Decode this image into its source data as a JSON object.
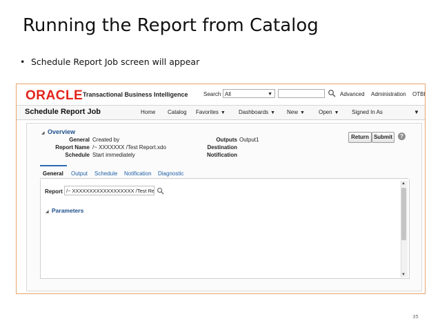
{
  "slide": {
    "title": "Running the Report from Catalog",
    "bullet_symbol": "•",
    "bullet": "Schedule Report Job screen will appear",
    "page_number": "35"
  },
  "app": {
    "logo": "ORACLE",
    "product": "Transactional Business Intelligence",
    "search_label": "Search",
    "search_scope": "All",
    "search_value": "",
    "top_links": [
      "Advanced",
      "Administration",
      "OTBI"
    ]
  },
  "nav": {
    "page_heading": "Schedule Report Job",
    "links": [
      "Home",
      "Catalog",
      "Favorites",
      "Dashboards",
      "New",
      "Open",
      "Signed In As"
    ]
  },
  "overview": {
    "title": "Overview",
    "general_label": "General",
    "general_value": "Created by",
    "report_name_label": "Report Name",
    "report_name_value": "/~  XXXXXXX  /Test Report.xdo",
    "schedule_label": "Schedule",
    "schedule_value": "Start immediately",
    "outputs_label": "Outputs",
    "outputs_value": "Output1",
    "destination_label": "Destination",
    "notification_label": "Notification",
    "return_button": "Return",
    "submit_button": "Submit",
    "help": "?"
  },
  "tabs": [
    "General",
    "Output",
    "Schedule",
    "Notification",
    "Diagnostic"
  ],
  "active_tab": "General",
  "general_tab": {
    "report_label": "Report",
    "report_value": "/~ XXXXXXXXXXXXXXXXXX /Test Rep",
    "parameters_title": "Parameters"
  },
  "colors": {
    "oracle_red": "#e2231a",
    "link_blue": "#1d5fa6",
    "frame_orange": "#e8a46c"
  }
}
